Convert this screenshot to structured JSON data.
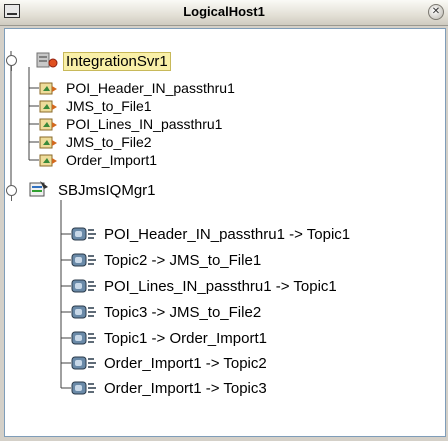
{
  "window": {
    "title": "LogicalHost1"
  },
  "tree": {
    "servers": [
      {
        "label": "IntegrationSvr1",
        "icon": "integration-server-icon",
        "children": [
          "POI_Header_IN_passthru1",
          "JMS_to_File1",
          "POI_Lines_IN_passthru1",
          "JMS_to_File2",
          "Order_Import1"
        ]
      },
      {
        "label": "SBJmsIQMgr1",
        "icon": "jms-manager-icon",
        "children": [
          "POI_Header_IN_passthru1 -> Topic1",
          "Topic2 -> JMS_to_File1",
          "POI_Lines_IN_passthru1 -> Topic1",
          "Topic3 -> JMS_to_File2",
          "Topic1 -> Order_Import1",
          "Order_Import1 -> Topic2",
          "Order_Import1 -> Topic3"
        ]
      }
    ]
  },
  "colors": {
    "selection": "#f9f0a8",
    "tree_lines": "#404040",
    "service_icon": "#d2691e",
    "topic_icon": "#4a6a8a"
  }
}
